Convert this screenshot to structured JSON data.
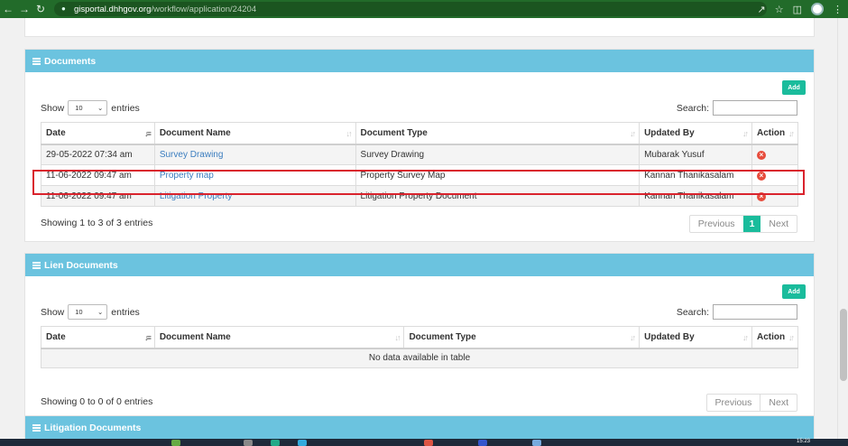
{
  "browser": {
    "url_host": "gisportal.dhhgov.org",
    "url_path": "/workflow/application/24204"
  },
  "documents": {
    "title": "Documents",
    "add_label": "Add",
    "show_label": "Show",
    "entries_label": "entries",
    "page_size": "10",
    "search_label": "Search:",
    "columns": [
      "Date",
      "Document Name",
      "Document Type",
      "Updated By",
      "Action"
    ],
    "rows": [
      {
        "date": "29-05-2022 07:34 am",
        "name": "Survey Drawing",
        "type": "Survey Drawing",
        "updated_by": "Mubarak Yusuf"
      },
      {
        "date": "11-06-2022 09:47 am",
        "name": "Property map",
        "type": "Property Survey Map",
        "updated_by": "Kannan Thanikasalam"
      },
      {
        "date": "11-06-2022 09:47 am",
        "name": "Litigation Property",
        "type": "Litigation Property Document",
        "updated_by": "Kannan Thanikasalam"
      }
    ],
    "info": "Showing 1 to 3 of 3 entries",
    "prev_label": "Previous",
    "page": "1",
    "next_label": "Next"
  },
  "lien": {
    "title": "Lien Documents",
    "add_label": "Add",
    "show_label": "Show",
    "entries_label": "entries",
    "page_size": "10",
    "search_label": "Search:",
    "columns": [
      "Date",
      "Document Name",
      "Document Type",
      "Updated By",
      "Action"
    ],
    "empty": "No data available in table",
    "info": "Showing 0 to 0 of 0 entries",
    "prev_label": "Previous",
    "next_label": "Next"
  },
  "litigation": {
    "title": "Litigation Documents"
  },
  "taskbar": {
    "time": "15:23"
  },
  "colors": {
    "header_bg": "#6bc3df",
    "accent": "#1abc9c",
    "highlight": "#d9232d",
    "link": "#3b7dbf"
  }
}
